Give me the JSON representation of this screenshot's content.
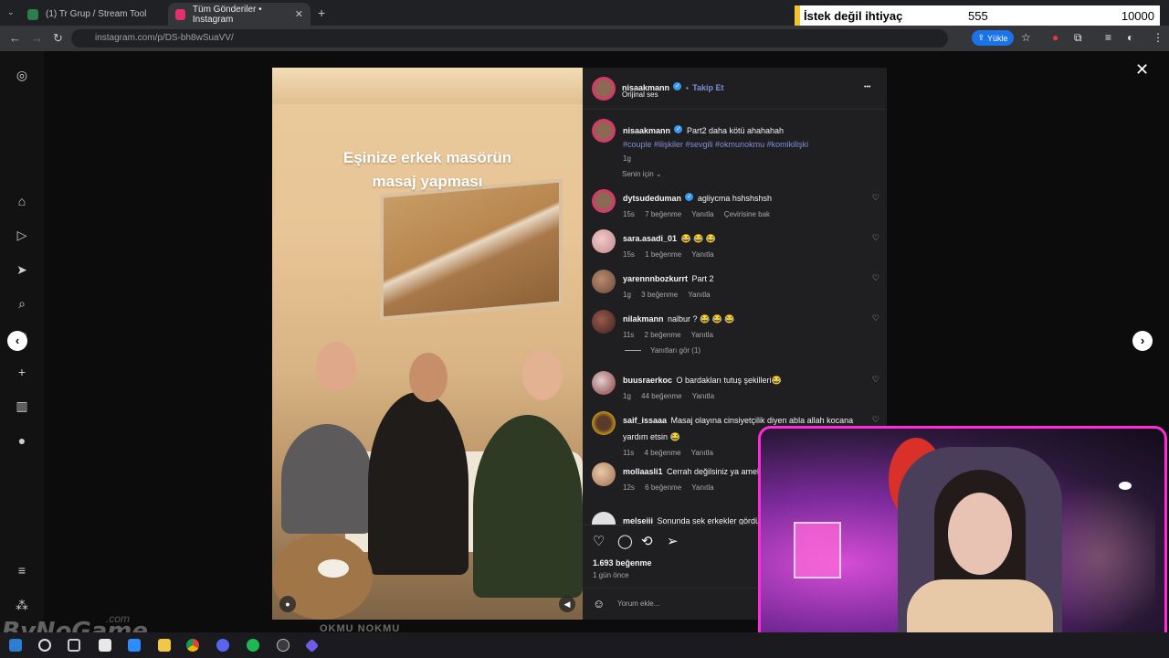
{
  "browser": {
    "tabs": [
      {
        "title": "(1) Tr Grup / Stream Tool",
        "favicon_color": "#2f7d4f"
      },
      {
        "title": "Tüm Gönderiler • Instagram",
        "favicon_color": "#e1306c"
      }
    ],
    "new_tab_symbol": "+",
    "url": "instagram.com/p/DS-bh8wSuaVV/",
    "upload_button": "Yükle",
    "icons": [
      "back-icon",
      "forward-icon",
      "reload-icon",
      "star-icon",
      "extensions-icon",
      "menu-icon"
    ]
  },
  "stream_counter": {
    "label": "İstek değil ihtiyaç",
    "current": "555",
    "goal": "10000"
  },
  "post": {
    "media_caption_line1": "Eşinize erkek masörün",
    "media_caption_line2": "masaj yapması",
    "header": {
      "username": "nisaakmann",
      "separator": "•",
      "follow": "Takip Et",
      "audio": "Orijinal ses",
      "more": "•••"
    },
    "caption": {
      "username": "nisaakmann",
      "text": "Part2 daha kötü ahahahah",
      "hashtags": "#couple #ilişkiler #sevgili #okmunokmu #komikilişki",
      "time": "1g"
    },
    "sort_label": "Senin için",
    "comments": [
      {
        "user": "dytsudeduman",
        "text": "agliycma hshshshsh",
        "time": "15s",
        "likes": "7 beğenme",
        "reply": "Yanıtla",
        "extra": "Çevirisine bak",
        "verified": true
      },
      {
        "user": "sara.asadi_01",
        "text": "😂 😂 😂",
        "time": "15s",
        "likes": "1 beğenme",
        "reply": "Yanıtla",
        "extra": "",
        "verified": false
      },
      {
        "user": "yarennnbozkurrt",
        "text": "Part 2",
        "time": "1g",
        "likes": "3 beğenme",
        "reply": "Yanıtla",
        "extra": "",
        "verified": false
      },
      {
        "user": "nilakmann",
        "text": "nalbur ? 😂 😂 😂",
        "time": "11s",
        "likes": "2 beğenme",
        "reply": "Yanıtla",
        "extra": "",
        "verified": false
      },
      {
        "user": "buusraerkoc",
        "text": "O bardakları tutuş şekilleri😂",
        "time": "1g",
        "likes": "44 beğenme",
        "reply": "Yanıtla",
        "extra": "",
        "verified": false
      },
      {
        "user": "saif_issaaa",
        "text": "Masaj olayına cinsiyetçilik diyen abla allah kocana yardım etsin 😂",
        "time": "11s",
        "likes": "4 beğenme",
        "reply": "Yanıtla",
        "extra": "",
        "verified": false
      },
      {
        "user": "mollaasli1",
        "text": "Cerrah değilsiniz ya amel (üstünlük) 😂 😂 😂",
        "time": "12s",
        "likes": "6 beğenme",
        "reply": "Yanıtla",
        "extra": "",
        "verified": false
      },
      {
        "user": "melseiii",
        "text": "Sonunda sek erkekler gördü",
        "time": "",
        "likes": "",
        "reply": "",
        "extra": "",
        "verified": false
      }
    ],
    "view_replies": "Yanıtları gör (1)",
    "likes": "1.693 beğenme",
    "posted": "1 gün önce",
    "comment_placeholder": "Yorum ekle..."
  },
  "watermark": {
    "brand": "ByNoGame",
    "suffix": ".com"
  },
  "bottom_text": "OKMU NOKMU"
}
